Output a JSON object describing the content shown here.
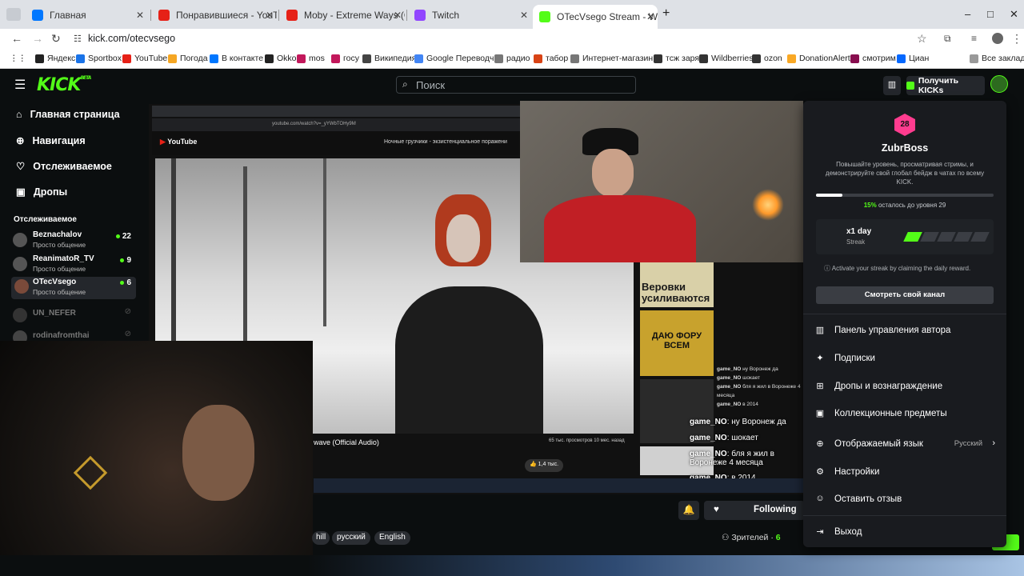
{
  "browser": {
    "tabs": [
      {
        "title": "Главная",
        "color": "#0077ff"
      },
      {
        "title": "Понравившиеся - YouTube",
        "color": "#e62117"
      },
      {
        "title": "Moby - Extreme Ways (Official",
        "color": "#e62117"
      },
      {
        "title": "Twitch",
        "color": "#9146ff"
      },
      {
        "title": "OTecVsego Stream - Watch Live",
        "color": "#53fc18"
      }
    ],
    "new_tab": "+",
    "window_controls": [
      "–",
      "□",
      "✕"
    ],
    "url": "kick.com/otecvsego",
    "bookmarks": [
      {
        "label": "Яндекс",
        "color": "#222"
      },
      {
        "label": "Sportbox",
        "color": "#1a73e8"
      },
      {
        "label": "YouTube",
        "color": "#e62117"
      },
      {
        "label": "Погода",
        "color": "#f5a623"
      },
      {
        "label": "В контакте",
        "color": "#0077ff"
      },
      {
        "label": "Okko",
        "color": "#222"
      },
      {
        "label": "mos",
        "color": "#c2185b"
      },
      {
        "label": "госу",
        "color": "#c2185b"
      },
      {
        "label": "Википедия",
        "color": "#444"
      },
      {
        "label": "Google Переводчик",
        "color": "#4285f4"
      },
      {
        "label": "радио",
        "color": "#777"
      },
      {
        "label": "табор",
        "color": "#d84315"
      },
      {
        "label": "Интернет-магазин...",
        "color": "#777"
      },
      {
        "label": "тсж заря",
        "color": "#333"
      },
      {
        "label": "Wildberries",
        "color": "#333"
      },
      {
        "label": "ozon",
        "color": "#333"
      },
      {
        "label": "DonationAlerts",
        "color": "#f9a825"
      },
      {
        "label": "смотрим",
        "color": "#880e4f"
      },
      {
        "label": "Циан",
        "color": "#0468ff"
      }
    ],
    "all_bookmarks": "Все закладки"
  },
  "kick": {
    "logo": "KICK",
    "logo_badge": "BETA",
    "search_placeholder": "Поиск",
    "get_kicks": "Получить KICKs",
    "nav": [
      {
        "label": "Главная страница",
        "icon": "home-icon"
      },
      {
        "label": "Навигация",
        "icon": "compass-icon"
      },
      {
        "label": "Отслеживаемое",
        "icon": "heart-icon"
      },
      {
        "label": "Дропы",
        "icon": "gift-icon"
      }
    ],
    "following_heading": "Отслеживаемое",
    "channels": [
      {
        "name": "Beznachalov",
        "sub": "Просто общение",
        "viewers": "22",
        "online": true
      },
      {
        "name": "ReanimatoR_TV",
        "sub": "Просто общение",
        "viewers": "9",
        "online": true
      },
      {
        "name": "OTecVsego",
        "sub": "Просто общение",
        "viewers": "6",
        "online": true
      },
      {
        "name": "UN_NEFER",
        "sub": "",
        "viewers": "",
        "online": false
      },
      {
        "name": "rodinafromthai",
        "sub": "",
        "viewers": "",
        "online": false
      }
    ],
    "stream": {
      "yt_title": "Ночные грузчики - экзистенциальное поражени",
      "yt_url": "youtube.com/watch?v=_yYWbTOHy9M",
      "video_caption": "wave (Official Audio)",
      "video_meta": "65 тыс. просмотров  10 мес. назад",
      "likes": "1,4 тыс.",
      "chat_lines": [
        {
          "user": "game_NO",
          "text": "ну Воронеж да"
        },
        {
          "user": "game_NO",
          "text": "шокает"
        },
        {
          "user": "game_NO",
          "text": "бля я жил в Воронеже 4 месяца"
        },
        {
          "user": "game_NO",
          "text": "в 2014"
        }
      ],
      "thumb1_text": "Веровки усиливаются",
      "thumb2_text": "ДАЮ ФОРУ ВСЕМ",
      "following_label": "Following",
      "tags": [
        "hill",
        "русский",
        "English"
      ],
      "viewers_label": "Зрителей",
      "viewers_count": "6"
    },
    "menu": {
      "level_badge": "28",
      "username": "ZubrBoss",
      "description": "Повышайте уровень, просматривая стримы, и демонстрируйте свой глобал бейдж в чатах по всему KICK.",
      "progress": 0.15,
      "progress_pct": "15%",
      "progress_text": "осталось до уровня 29",
      "streak_title": "x1 day",
      "streak_sub": "Streak",
      "streak_filled": 1,
      "streak_total": 5,
      "streak_info": "Activate your streak by claiming the daily reward.",
      "watch_channel": "Смотреть свой канал",
      "items": [
        {
          "label": "Панель управления автора",
          "icon": "chart-icon"
        },
        {
          "label": "Подписки",
          "icon": "sparkle-icon"
        },
        {
          "label": "Дропы и вознаграждение",
          "icon": "gift-icon"
        },
        {
          "label": "Коллекционные предметы",
          "icon": "collection-icon"
        },
        {
          "label": "Отображаемый язык",
          "icon": "globe-icon",
          "value": "Русский"
        },
        {
          "label": "Настройки",
          "icon": "gear-icon"
        },
        {
          "label": "Оставить отзыв",
          "icon": "feedback-icon"
        },
        {
          "label": "Выход",
          "icon": "logout-icon"
        }
      ]
    }
  },
  "colors": {
    "accent": "#53fc18",
    "menu_bg": "#191b1f",
    "page_bg": "#0b0e0f",
    "level_badge": "#ff3c8f"
  }
}
